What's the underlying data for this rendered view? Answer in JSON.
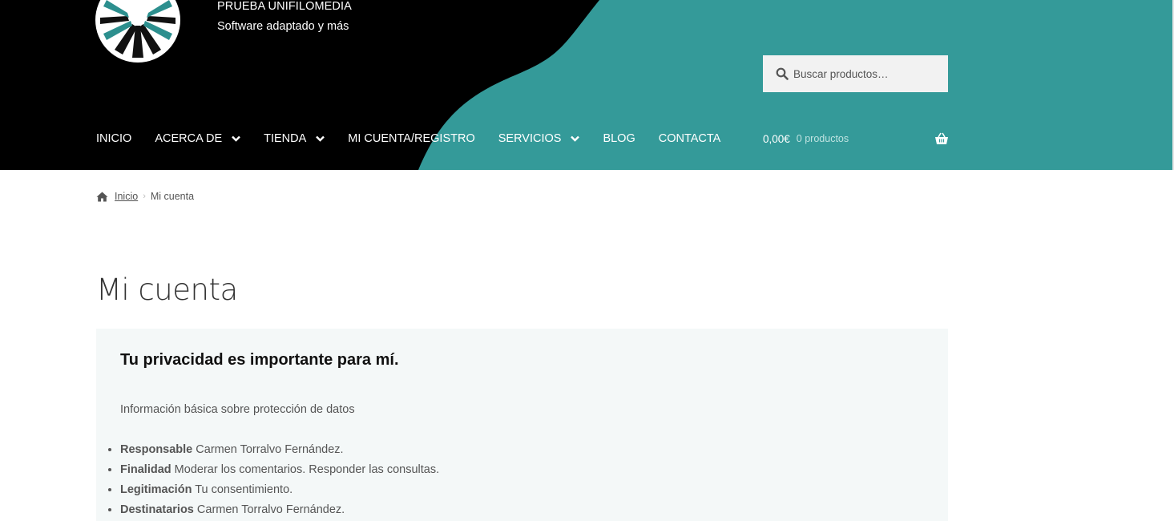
{
  "site": {
    "title": "PRUEBA UNIFILOMEDIA",
    "tagline": "Software adaptado y más"
  },
  "colors": {
    "header_bg": "#000000",
    "accent_teal": "#349a99",
    "notice_bg": "#f4f8f8"
  },
  "search": {
    "icon": "search-icon",
    "placeholder": "Buscar productos…"
  },
  "nav": {
    "items": [
      {
        "label": "INICIO"
      },
      {
        "label": "ACERCA DE"
      },
      {
        "label": "TIENDA"
      },
      {
        "label": "MI CUENTA/REGISTRO"
      },
      {
        "label": "SERVICIOS"
      },
      {
        "label": "BLOG"
      },
      {
        "label": "CONTACTA"
      }
    ]
  },
  "cart": {
    "amount": "0,00€",
    "count": "0 productos",
    "icon": "basket-icon"
  },
  "breadcrumb": {
    "home": "Inicio",
    "current": "Mi cuenta"
  },
  "page": {
    "title": "Mi cuenta"
  },
  "privacy": {
    "heading": "Tu privacidad es importante para mí.",
    "intro": "Información básica sobre protección de datos",
    "items": [
      {
        "label": "Responsable",
        "text": " Carmen Torralvo Fernández."
      },
      {
        "label": "Finalidad",
        "text": "  Moderar los comentarios. Responder las consultas."
      },
      {
        "label": "Legitimación",
        "text": " Tu consentimiento."
      },
      {
        "label": "Destinatarios",
        "text": "  Carmen Torralvo Fernández."
      }
    ]
  }
}
